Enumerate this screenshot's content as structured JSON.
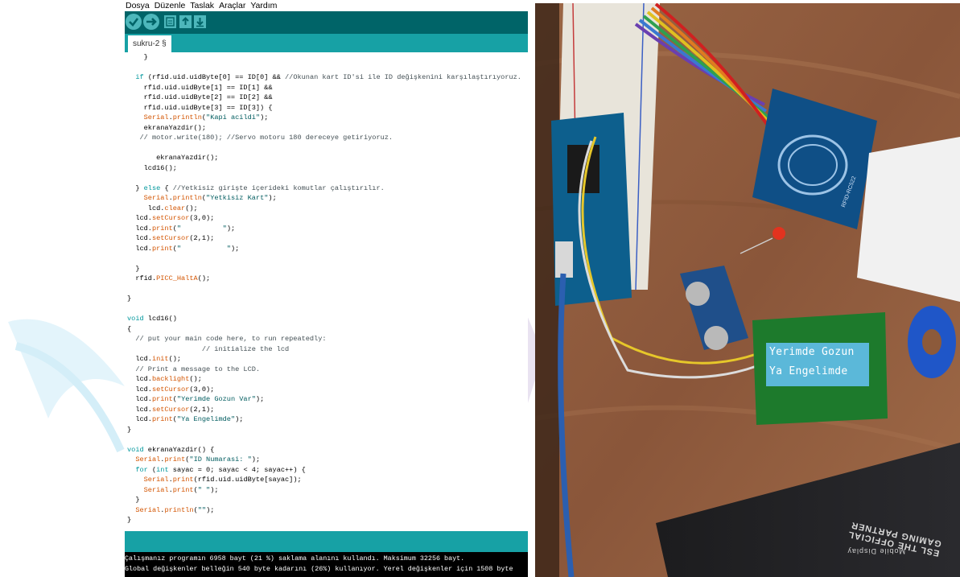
{
  "menu": [
    "Dosya",
    "Düzenle",
    "Taslak",
    "Araçlar",
    "Yardım"
  ],
  "toolbar": {
    "buttons": [
      "verify-button",
      "upload-button",
      "new-button",
      "open-button",
      "save-button"
    ]
  },
  "tab": {
    "label": "sukru-2 §"
  },
  "code_lines": [
    "    }",
    "",
    "  if (rfid.uid.uidByte[0] == ID[0] && //Okunan kart ID'si ile ID değişkenini karşılaştırıyoruz.",
    "    rfid.uid.uidByte[1] == ID[1] &&",
    "    rfid.uid.uidByte[2] == ID[2] &&",
    "    rfid.uid.uidByte[3] == ID[3]) {",
    "    Serial.println(\"Kapi acildi\");",
    "    ekranaYazdir();",
    "   // motor.write(180); //Servo motoru 180 dereceye getiriyoruz.",
    "",
    "       ekranaYazdir();",
    "    lcd16();",
    "",
    "  } else { //Yetkisiz girişte içerideki komutlar çalıştırılır.",
    "    Serial.println(\"Yetkisiz Kart\");",
    "     lcd.clear();",
    "  lcd.setCursor(3,0);",
    "  lcd.print(\"          \");",
    "  lcd.setCursor(2,1);",
    "  lcd.print(\"           \");",
    "",
    "  }",
    "  rfid.PICC_HaltA();",
    "",
    "}",
    "",
    "void lcd16()",
    "{",
    "  // put your main code here, to run repeatedly:",
    "                  // initialize the lcd",
    "  lcd.init();",
    "  // Print a message to the LCD.",
    "  lcd.backlight();",
    "  lcd.setCursor(3,0);",
    "  lcd.print(\"Yerimde Gozun Var\");",
    "  lcd.setCursor(2,1);",
    "  lcd.print(\"Ya Engelimde\");",
    "}",
    "",
    "void ekranaYazdir() {",
    "  Serial.print(\"ID Numarasi: \");",
    "  for (int sayac = 0; sayac < 4; sayac++) {",
    "    Serial.print(rfid.uid.uidByte[sayac]);",
    "    Serial.print(\" \");",
    "  }",
    "  Serial.println(\"\");",
    "}"
  ],
  "console": {
    "line1": "Çalışmanız programın 6958 bayt (21 %) saklama alanını kullandı. Maksimum 32256 bayt.",
    "line2": "Global değişkenler belleğin 540 byte kadarını  (26%) kullanıyor. Yerel değişkenler için 1508 byte"
  },
  "photo": {
    "lcd_line1": "Yerimde Gozun",
    "lcd_line2": "Ya Engelimde",
    "mousepad_text1": "ESL THE OFFICIAL GAMING PARTNER",
    "mousepad_text2": "Mobile Display",
    "rfid_module_label": "RFID-RC522"
  },
  "colors": {
    "ide_toolbar": "#006468",
    "ide_tabbar": "#17a1a5",
    "ide_console": "#000000",
    "keyword": "#00979c",
    "function": "#d35400",
    "lcd_backlight": "#5bb8d9"
  }
}
